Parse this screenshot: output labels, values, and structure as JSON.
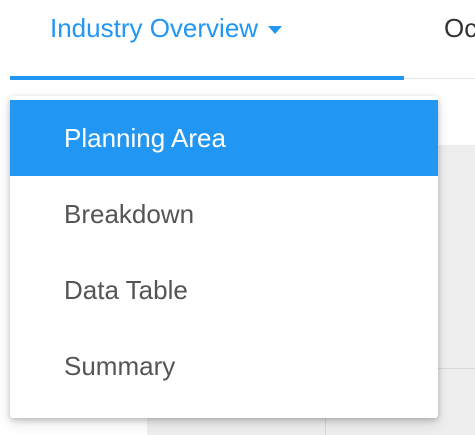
{
  "tabs": {
    "active_label": "Industry Overview",
    "next_label_partial": "Oc"
  },
  "dropdown": {
    "items": [
      {
        "label": "Planning Area",
        "selected": true
      },
      {
        "label": "Breakdown",
        "selected": false
      },
      {
        "label": "Data Table",
        "selected": false
      },
      {
        "label": "Summary",
        "selected": false
      }
    ]
  },
  "colors": {
    "accent": "#2196f3",
    "menu_text": "#555555",
    "background_panel": "#eeeeee"
  },
  "icons": {
    "tab_caret": "caret-down-icon"
  }
}
